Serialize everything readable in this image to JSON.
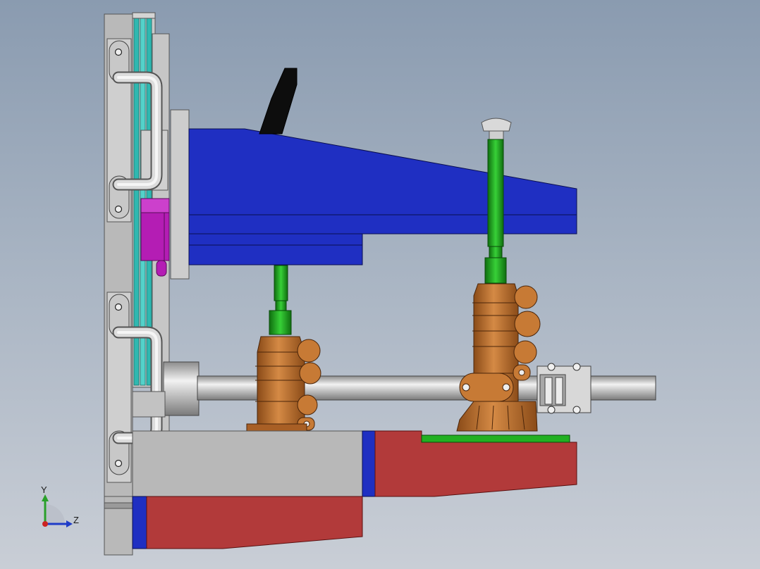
{
  "view": {
    "kind": "cad-assembly-side-view",
    "background_top": "#8a9bb0",
    "background_bottom": "#c9ced6"
  },
  "parts": {
    "frame_color": "#b4b4b4",
    "rail_color": "#2fb8b0",
    "beam_color": "#1f2fc2",
    "base_color": "#b23a3a",
    "cylinder_color": "#c77a35",
    "rod_color": "#22b022",
    "sensor_color": "#b41db4",
    "shaft_color": "#c8c8c8",
    "plate_color": "#22b022"
  },
  "triad": {
    "y_label": "Y",
    "z_label": "Z",
    "y_color": "#2aa02a",
    "z_color": "#1f3cc8",
    "x_color": "#cc2222"
  }
}
